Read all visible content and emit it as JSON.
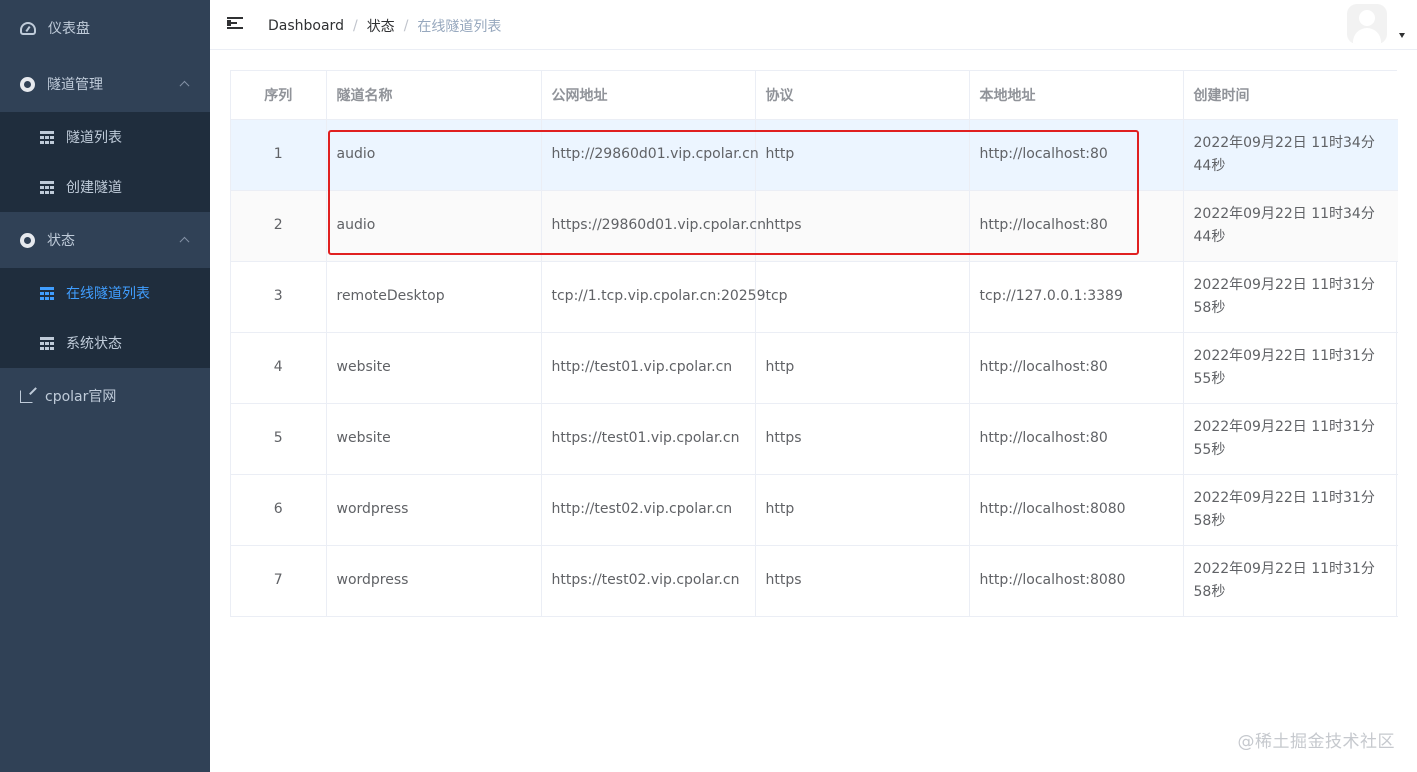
{
  "sidebar": {
    "dashboard": {
      "label": "仪表盘",
      "icon": "dashboard-icon"
    },
    "tunnel_mgmt": {
      "label": "隧道管理",
      "icon": "circle-icon",
      "items": [
        {
          "label": "隧道列表",
          "icon": "grid-icon"
        },
        {
          "label": "创建隧道",
          "icon": "grid-icon"
        }
      ]
    },
    "status": {
      "label": "状态",
      "icon": "circle-icon",
      "items": [
        {
          "label": "在线隧道列表",
          "icon": "grid-icon",
          "active": true
        },
        {
          "label": "系统状态",
          "icon": "grid-icon"
        }
      ]
    },
    "website": {
      "label": "cpolar官网",
      "icon": "external-link-icon"
    }
  },
  "header": {
    "breadcrumb": [
      "Dashboard",
      "状态",
      "在线隧道列表"
    ],
    "separator": "/"
  },
  "table": {
    "columns": [
      "序列",
      "隧道名称",
      "公网地址",
      "协议",
      "本地地址",
      "创建时间"
    ],
    "rows": [
      {
        "idx": "1",
        "name": "audio",
        "public_url": "http://29860d01.vip.cpolar.cn",
        "protocol": "http",
        "local": "http://localhost:80",
        "created": "2022年09月22日 11时34分44秒"
      },
      {
        "idx": "2",
        "name": "audio",
        "public_url": "https://29860d01.vip.cpolar.cn",
        "protocol": "https",
        "local": "http://localhost:80",
        "created": "2022年09月22日 11时34分44秒"
      },
      {
        "idx": "3",
        "name": "remoteDesktop",
        "public_url": "tcp://1.tcp.vip.cpolar.cn:20259",
        "protocol": "tcp",
        "local": "tcp://127.0.0.1:3389",
        "created": "2022年09月22日 11时31分58秒"
      },
      {
        "idx": "4",
        "name": "website",
        "public_url": "http://test01.vip.cpolar.cn",
        "protocol": "http",
        "local": "http://localhost:80",
        "created": "2022年09月22日 11时31分55秒"
      },
      {
        "idx": "5",
        "name": "website",
        "public_url": "https://test01.vip.cpolar.cn",
        "protocol": "https",
        "local": "http://localhost:80",
        "created": "2022年09月22日 11时31分55秒"
      },
      {
        "idx": "6",
        "name": "wordpress",
        "public_url": "http://test02.vip.cpolar.cn",
        "protocol": "http",
        "local": "http://localhost:8080",
        "created": "2022年09月22日 11时31分58秒"
      },
      {
        "idx": "7",
        "name": "wordpress",
        "public_url": "https://test02.vip.cpolar.cn",
        "protocol": "https",
        "local": "http://localhost:8080",
        "created": "2022年09月22日 11时31分58秒"
      }
    ]
  },
  "watermark": "@稀土掘金技术社区",
  "colors": {
    "sidebar_bg": "#304156",
    "submenu_bg": "#1f2d3d",
    "active": "#409eff",
    "highlight_border": "#e02020",
    "hover_row": "#ecf5ff"
  }
}
